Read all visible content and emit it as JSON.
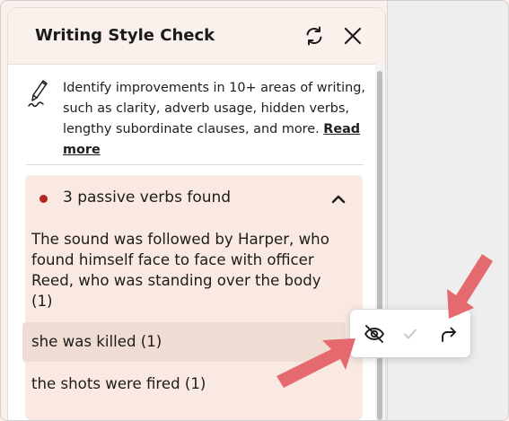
{
  "panel": {
    "title": "Writing Style Check",
    "refresh_icon": "refresh-icon",
    "close_icon": "close-icon"
  },
  "intro": {
    "icon": "pencil-icon",
    "text": "Identify improvements in 10+ areas of writing, such as clarity, adverb usage, hidden verbs, lengthy subordinate clauses, and more.",
    "read_more": "Read more"
  },
  "card": {
    "status_color": "#b3261e",
    "title": "3 passive verbs found",
    "toggle_icon": "chevron-up-icon",
    "items": [
      {
        "label": "The sound was followed by Harper, who found himself face to face with officer Reed, who was standing over the body (1)"
      },
      {
        "label": "she was killed (1)"
      },
      {
        "label": "the shots were fired (1)"
      }
    ]
  },
  "toolbar": {
    "ignore_icon": "eye-off-icon",
    "accept_icon": "check-icon",
    "next_icon": "redo-arrow-icon"
  },
  "colors": {
    "annotation_arrow": "#e56a6f",
    "background": "#fbf1ec",
    "card": "#f9e9e2",
    "selected_item": "#efdcd2"
  }
}
